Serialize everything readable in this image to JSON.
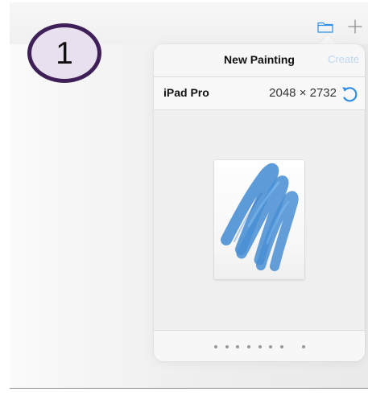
{
  "tutorial": {
    "step_number": "1"
  },
  "toolbar": {
    "icons": [
      "folder-icon",
      "plus-icon"
    ],
    "accent": "#2f8ee8"
  },
  "new_painting": {
    "title": "New Painting",
    "create_label": "Create",
    "device": {
      "name": "iPad Pro",
      "dimensions": "2048 × 2732",
      "rotate_icon": "rotate-icon"
    },
    "preview": {
      "brush_color": "#4a8fd4"
    },
    "pagination": {
      "count": 9,
      "active_index": 7
    }
  },
  "colors": {
    "badge_border": "#3f1f57",
    "badge_fill": "#e8e0ef",
    "disabled_create": "#bfd7ef"
  }
}
